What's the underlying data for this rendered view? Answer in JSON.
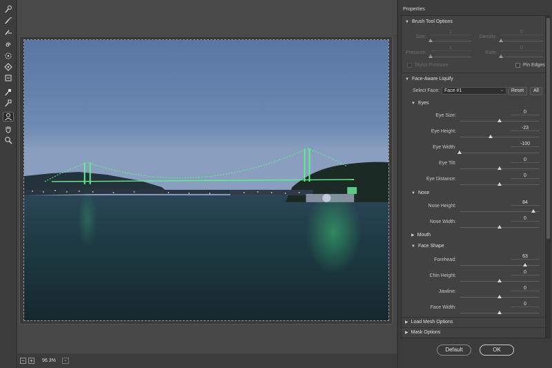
{
  "properties": {
    "title": "Properties",
    "brush": {
      "header": "Brush Tool Options",
      "size_label": "Size:",
      "size_value": "1",
      "density_label": "Density:",
      "density_value": "0",
      "pressure_label": "Pressure:",
      "pressure_value": "1",
      "rate_label": "Rate:",
      "rate_value": "0",
      "stylus_label": "Stylus Pressure",
      "pin_label": "Pin Edges"
    },
    "face": {
      "header": "Face-Aware Liquify",
      "select_label": "Select Face:",
      "select_value": "Face #1",
      "reset_label": "Reset",
      "all_label": "All"
    },
    "eyes": {
      "header": "Eyes",
      "eye_size_label": "Eye Size:",
      "eye_size_value": "0",
      "eye_size_frac": 0.5,
      "eye_height_label": "Eye Height:",
      "eye_height_value": "-23",
      "eye_height_frac": 0.385,
      "eye_width_label": "Eye Width:",
      "eye_width_value": "-100",
      "eye_width_frac": 0.0,
      "eye_tilt_label": "Eye Tilt:",
      "eye_tilt_value": "0",
      "eye_tilt_frac": 0.5,
      "eye_distance_label": "Eye Distance:",
      "eye_distance_value": "0",
      "eye_distance_frac": 0.5
    },
    "nose": {
      "header": "Nose",
      "nose_height_label": "Nose Height:",
      "nose_height_value": "84",
      "nose_height_frac": 0.92,
      "nose_width_label": "Nose Width:",
      "nose_width_value": "0",
      "nose_width_frac": 0.5
    },
    "mouth": {
      "header": "Mouth"
    },
    "face_shape": {
      "header": "Face Shape",
      "forehead_label": "Forehead:",
      "forehead_value": "63",
      "forehead_frac": 0.815,
      "chin_label": "Chin Height:",
      "chin_value": "0",
      "chin_frac": 0.5,
      "jawline_label": "Jawline:",
      "jawline_value": "0",
      "jawline_frac": 0.5,
      "face_width_label": "Face Width:",
      "face_width_value": "0",
      "face_width_frac": 0.5
    },
    "load_mesh": {
      "header": "Load Mesh Options"
    },
    "mask": {
      "header": "Mask Options"
    }
  },
  "status": {
    "zoom_value": "96.3%",
    "zoom_out": "−",
    "zoom_in": "+",
    "dropdown": "⌄"
  },
  "dialog": {
    "default_label": "Default",
    "ok_label": "OK"
  },
  "colors": {
    "bridge_light": "#5ff28a",
    "water": "#18333a",
    "sky": "#5b7aa8",
    "panel": "#424242"
  }
}
